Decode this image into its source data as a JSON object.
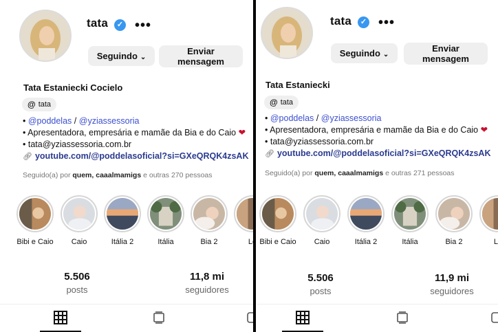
{
  "left": {
    "username": "tata",
    "more_label": "•••",
    "follow_button": "Seguindo",
    "message_button": [
      "Enviar",
      "mensagem"
    ],
    "full_name": "Tata Estaniecki Cocielo",
    "threads_label": "tata",
    "bio": {
      "mention1": "@poddelas",
      "separator": "/",
      "mention2": "@yziassessoria",
      "line2": "Apresentadora, empresária e mamãe da Bia e do Caio",
      "line3": "tata@yziassessoria.com.br",
      "link": "youtube.com/@poddelasoficial?si=GXeQRQK4zsAK"
    },
    "followed_by": {
      "prefix": "Seguido(a) por",
      "names": "quem, caaalmamigs",
      "suffix": "e outras 270 pessoas"
    },
    "stories": [
      "Bibi e Caio",
      "Caio",
      "Itália 2",
      "Itália",
      "Bia 2",
      "Lo"
    ],
    "stats": {
      "posts": {
        "value": "5.506",
        "label": "posts"
      },
      "followers": {
        "value": "11,8 mi",
        "label": "seguidores"
      }
    }
  },
  "right": {
    "username": "tata",
    "more_label": "•••",
    "follow_button": "Seguindo",
    "message_button": [
      "Enviar",
      "mensagem"
    ],
    "full_name": "Tata Estaniecki",
    "threads_label": "tata",
    "bio": {
      "mention1": "@poddelas",
      "separator": "/",
      "mention2": "@yziassessoria",
      "line2": "Apresentadora, empresária e mamãe da Bia e do Caio",
      "line3": "tata@yziassessoria.com.br",
      "link": "youtube.com/@poddelasoficial?si=GXeQRQK4zsAK"
    },
    "followed_by": {
      "prefix": "Seguido(a) por",
      "names": "quem, caaalmamigs",
      "suffix": "e outras 271 pessoas"
    },
    "stories": [
      "Bibi e Caio",
      "Caio",
      "Itália 2",
      "Itália",
      "Bia 2",
      "Lo"
    ],
    "stats": {
      "posts": {
        "value": "5.506",
        "label": "posts"
      },
      "followers": {
        "value": "11,9 mi",
        "label": "seguidores"
      }
    }
  },
  "icons": {
    "verified": "verified-badge-icon",
    "threads": "threads-icon",
    "link": "link-icon",
    "grid_tab": "grid-icon",
    "reels_tab": "reels-icon"
  },
  "colors": {
    "verified": "#3897f0",
    "mention": "#3b4fd0",
    "button_bg": "#efefef"
  }
}
